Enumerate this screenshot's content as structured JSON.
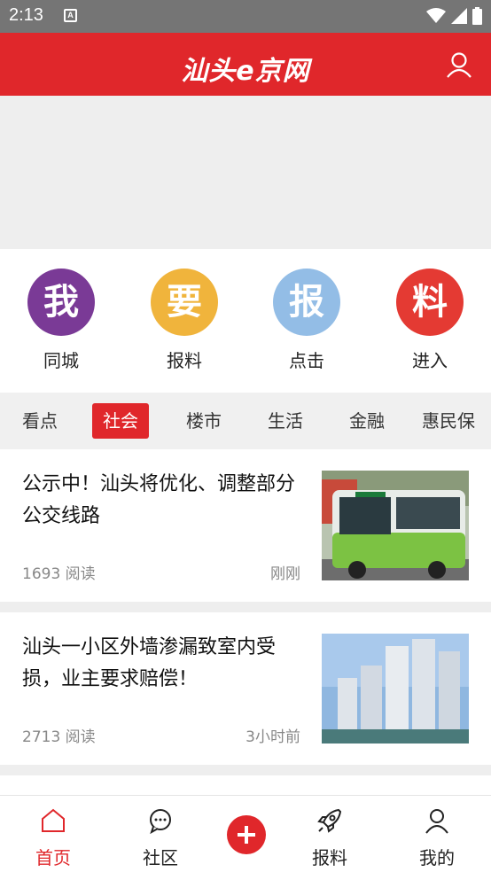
{
  "status_bar": {
    "time": "2:13",
    "notification_icon": "A"
  },
  "header": {
    "logo": "汕头e京网",
    "user_icon": "user-icon"
  },
  "quick_actions": [
    {
      "glyph": "我",
      "label": "同城",
      "color": "#7a3a96"
    },
    {
      "glyph": "要",
      "label": "报料",
      "color": "#f0b43c"
    },
    {
      "glyph": "报",
      "label": "点击",
      "color": "#93bde6"
    },
    {
      "glyph": "料",
      "label": "进入",
      "color": "#e43a33"
    }
  ],
  "categories": [
    {
      "label": "看点",
      "active": false
    },
    {
      "label": "社会",
      "active": true
    },
    {
      "label": "楼市",
      "active": false
    },
    {
      "label": "生活",
      "active": false
    },
    {
      "label": "金融",
      "active": false
    },
    {
      "label": "惠民保",
      "active": false
    }
  ],
  "news": [
    {
      "title": "公示中！汕头将优化、调整部分公交线路",
      "reads": "1693 阅读",
      "time": "刚刚",
      "thumb": "green-bus-photo"
    },
    {
      "title": "汕头一小区外墙渗漏致室内受损，业主要求赔偿！",
      "reads": "2713 阅读",
      "time": "3小时前",
      "thumb": "residential-towers-photo"
    }
  ],
  "bottom_nav": [
    {
      "label": "首页",
      "icon": "home-icon",
      "active": true
    },
    {
      "label": "社区",
      "icon": "chat-bubble-icon",
      "active": false
    },
    {
      "label": "报料",
      "icon": "rocket-icon",
      "active": false
    },
    {
      "label": "我的",
      "icon": "user-icon",
      "active": false
    }
  ],
  "add_button_icon": "plus-icon",
  "colors": {
    "brand_red": "#e0272b",
    "status_bar": "#757575",
    "banner_bg": "#eeeeee"
  }
}
